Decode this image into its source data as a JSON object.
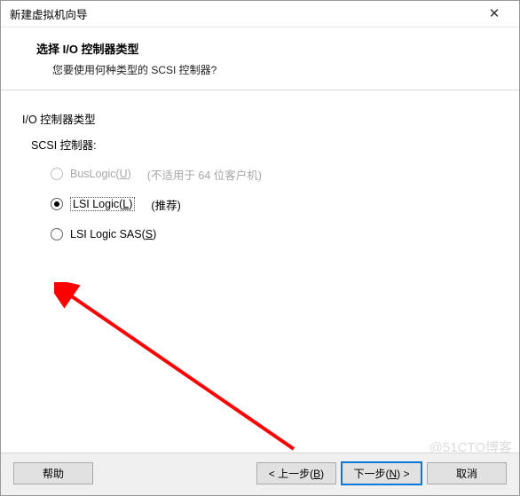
{
  "window": {
    "title": "新建虚拟机向导"
  },
  "header": {
    "title": "选择 I/O 控制器类型",
    "subtitle": "您要使用何种类型的 SCSI 控制器?"
  },
  "content": {
    "group_label": "I/O 控制器类型",
    "scsi_label": "SCSI 控制器:",
    "options": {
      "buslogic": {
        "prefix": "BusLogic(",
        "key": "U",
        "suffix": ")",
        "hint": "(不适用于 64 位客户机)",
        "enabled": false,
        "selected": false
      },
      "lsilogic": {
        "prefix": "LSI Logic(",
        "key": "L",
        "suffix": ")",
        "hint": "(推荐)",
        "enabled": true,
        "selected": true
      },
      "lsisas": {
        "prefix": "LSI Logic SAS(",
        "key": "S",
        "suffix": ")",
        "hint": "",
        "enabled": true,
        "selected": false
      }
    }
  },
  "footer": {
    "help": "帮助",
    "back_prefix": "< 上一步(",
    "back_key": "B",
    "back_suffix": ")",
    "next_prefix": "下一步(",
    "next_key": "N",
    "next_suffix": ") >",
    "cancel": "取消"
  },
  "watermark": "@51CTO博客",
  "colors": {
    "accent": "#0078d7",
    "arrow": "#ff0000"
  }
}
